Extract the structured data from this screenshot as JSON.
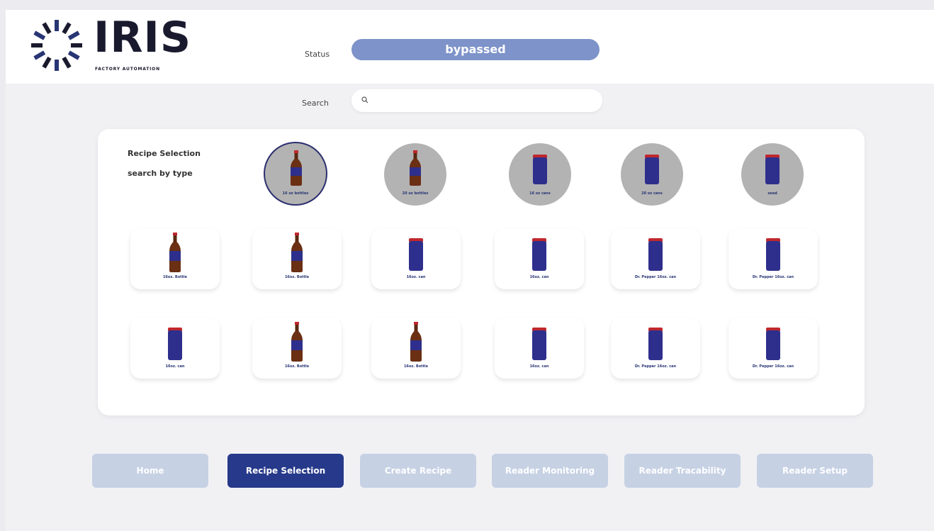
{
  "header": {
    "logo_text": "IRIS",
    "logo_tagline": "FACTORY AUTOMATION",
    "status_label": "Status",
    "status_value": "bypassed",
    "search_label": "Search",
    "search_placeholder": ""
  },
  "panel": {
    "title": "Recipe Selection",
    "subtitle": "search by type",
    "types": [
      {
        "label": "16 oz bottles",
        "icon": "bottle-icon",
        "selected": true
      },
      {
        "label": "20 oz bottles",
        "icon": "bottle-icon",
        "selected": false
      },
      {
        "label": "16 oz cans",
        "icon": "can-icon",
        "selected": false
      },
      {
        "label": "20 oz cans",
        "icon": "can-icon",
        "selected": false
      },
      {
        "label": "seed",
        "icon": "can-icon",
        "selected": false
      }
    ],
    "recipes_row1": [
      {
        "label": "16oz. Bottle",
        "icon": "bottle-icon"
      },
      {
        "label": "16oz. Bottle",
        "icon": "bottle-icon"
      },
      {
        "label": "16oz. can",
        "icon": "can-icon"
      },
      {
        "label": "16oz. can",
        "icon": "can-icon"
      },
      {
        "label": "Dr. Pepper 16oz. can",
        "icon": "can-icon"
      },
      {
        "label": "Dr. Pepper 16oz. can",
        "icon": "can-icon"
      }
    ],
    "recipes_row2": [
      {
        "label": "16oz. can",
        "icon": "can-icon"
      },
      {
        "label": "16oz. Bottle",
        "icon": "bottle-icon"
      },
      {
        "label": "16oz. Bottle",
        "icon": "bottle-icon"
      },
      {
        "label": "16oz. can",
        "icon": "can-icon"
      },
      {
        "label": "Dr. Pepper 16oz. can",
        "icon": "can-icon"
      },
      {
        "label": "Dr. Pepper 16oz. can",
        "icon": "can-icon"
      }
    ]
  },
  "nav": {
    "buttons": [
      {
        "label": "Home",
        "active": false
      },
      {
        "label": "Recipe Selection",
        "active": true
      },
      {
        "label": "Create Recipe",
        "active": false
      },
      {
        "label": "Reader Monitoring",
        "active": false
      },
      {
        "label": "Reader Tracability",
        "active": false
      },
      {
        "label": "Reader Setup",
        "active": false
      }
    ]
  },
  "colors": {
    "status_pill": "#7d93c9",
    "nav_active": "#26398a",
    "nav_inactive": "#c6d1e4",
    "can_body": "#2e2f8c",
    "can_lid": "#c0272d",
    "bottle_brown": "#6b2f14"
  }
}
